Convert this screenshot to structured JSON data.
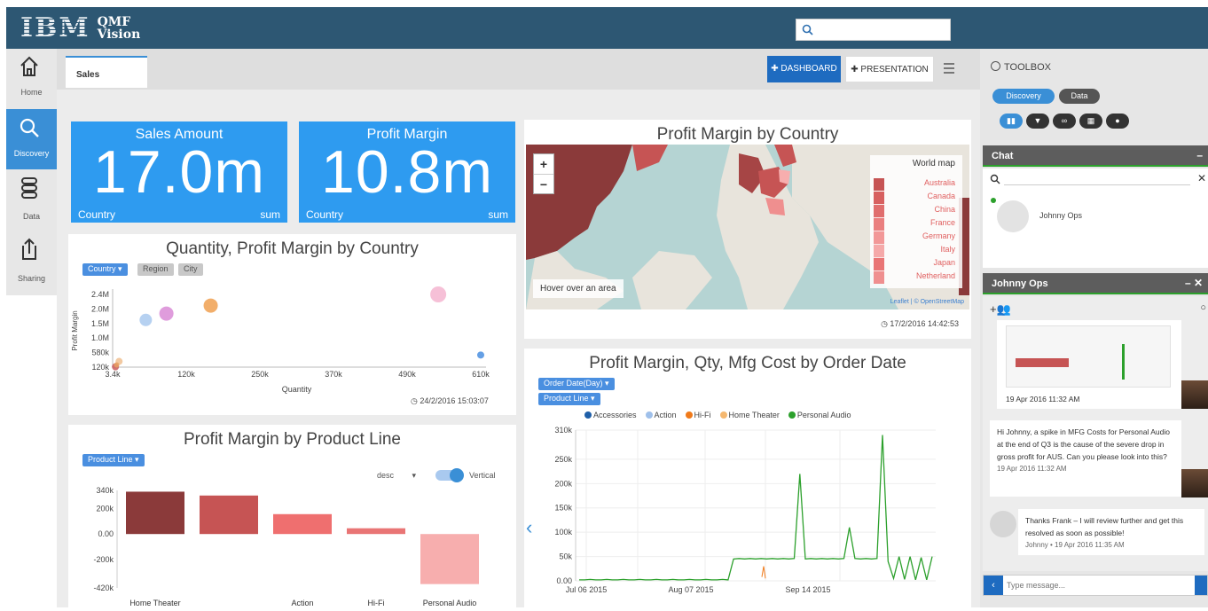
{
  "header": {
    "logo_brand": "IBM",
    "logo_product_line1": "QMF",
    "logo_product_line2": "Vision"
  },
  "nav": [
    {
      "label": "Home",
      "icon": "home-icon"
    },
    {
      "label": "Discovery",
      "icon": "search-icon",
      "active": true
    },
    {
      "label": "Data",
      "icon": "database-icon"
    },
    {
      "label": "Sharing",
      "icon": "share-icon"
    }
  ],
  "tabs": [
    {
      "label": "Sales"
    }
  ],
  "toolbar": {
    "dashboard_label": "✚ DASHBOARD",
    "presentation_label": "✚ PRESENTATION"
  },
  "kpis": [
    {
      "title": "Sales Amount",
      "value": "17.0m",
      "left_label": "Country",
      "right_label": "sum"
    },
    {
      "title": "Profit Margin",
      "value": "10.8m",
      "left_label": "Country",
      "right_label": "sum"
    }
  ],
  "scatter_panel": {
    "title": "Quantity, Profit Margin by Country",
    "chips": [
      "Country ▾",
      "Region",
      "City"
    ],
    "timestamp": "◷ 24/2/2016 15:03:07"
  },
  "product_panel": {
    "title": "Profit Margin by Product Line",
    "chip": "Product Line ▾",
    "sort_value": "desc",
    "vertical_label": "Vertical"
  },
  "map_panel": {
    "title": "Profit Margin by Country",
    "zoom_in": "+",
    "zoom_out": "−",
    "legend_title": "World map",
    "legend_items": [
      "Australia",
      "Canada",
      "China",
      "France",
      "Germany",
      "Italy",
      "Japan",
      "Netherland"
    ],
    "hover_text": "Hover over an area",
    "attribution": "Leaflet | © OpenStreetMap",
    "timestamp": "◷ 17/2/2016 14:42:53"
  },
  "line_panel": {
    "title": "Profit Margin, Qty, Mfg Cost by Order Date",
    "chips": [
      "Order Date(Day) ▾",
      "Product Line ▾"
    ]
  },
  "toolbox": {
    "title": "TOOLBOX",
    "tabs": [
      "Discovery",
      "Data"
    ],
    "chat_title": "Chat",
    "chat_user": "Johnny Ops",
    "conv_title": "Johnny Ops",
    "messages": [
      {
        "text": "19 Apr 2016 11:32 AM"
      },
      {
        "text": "Hi Johnny, a spike in MFG Costs for Personal Audio at the end of Q3 is the cause of the severe drop in gross profit for AUS. Can you please look into this?",
        "time": "19 Apr 2016 11:32 AM"
      },
      {
        "text": "Thanks Frank – I will review further and get this resolved as soon as possible!",
        "time": "Johnny • 19 Apr 2016 11:35 AM"
      }
    ],
    "message_placeholder": "Type message..."
  },
  "chart_data": [
    {
      "type": "scatter",
      "title": "Quantity, Profit Margin by Country",
      "xlabel": "Quantity",
      "ylabel": "Profit Margin",
      "xticks": [
        "3.4k",
        "120k",
        "250k",
        "370k",
        "490k",
        "610k"
      ],
      "yticks": [
        "120k",
        "580k",
        "1.0M",
        "1.5M",
        "2.0M",
        "2.4M"
      ],
      "xlim": [
        3400,
        610000
      ],
      "ylim": [
        120000,
        2400000
      ],
      "points": [
        {
          "x": 8000,
          "y": 130000,
          "color": "#c95a5a",
          "r": 4
        },
        {
          "x": 14000,
          "y": 300000,
          "color": "#f0c090",
          "r": 4
        },
        {
          "x": 10000,
          "y": 190000,
          "color": "#e8a060",
          "r": 3
        },
        {
          "x": 58000,
          "y": 1600000,
          "color": "#a9c9ef",
          "r": 7
        },
        {
          "x": 92000,
          "y": 1800000,
          "color": "#d98bd6",
          "r": 8
        },
        {
          "x": 165000,
          "y": 2050000,
          "color": "#f0a050",
          "r": 8
        },
        {
          "x": 540000,
          "y": 2450000,
          "color": "#f5b5d0",
          "r": 9
        },
        {
          "x": 610000,
          "y": 500000,
          "color": "#4a8fe0",
          "r": 4
        }
      ]
    },
    {
      "type": "bar",
      "title": "Profit Margin by Product Line",
      "categories": [
        "Home Theater",
        "",
        "Action",
        "Hi-Fi",
        "Personal Audio"
      ],
      "values": [
        330000,
        300000,
        155000,
        45000,
        -390000
      ],
      "colors": [
        "#8b3a3a",
        "#c65454",
        "#ef6f6f",
        "#e97575",
        "#f7aeae"
      ],
      "yticks": [
        "340k",
        "200k",
        "0.00",
        "-200k",
        "-420k"
      ],
      "ylim": [
        -420000,
        340000
      ]
    },
    {
      "type": "line",
      "title": "Profit Margin, Qty, Mfg Cost by Order Date",
      "legend": [
        {
          "name": "Accessories",
          "color": "#1f5fa8"
        },
        {
          "name": "Action",
          "color": "#9fc0ea"
        },
        {
          "name": "Hi-Fi",
          "color": "#f07a1a"
        },
        {
          "name": "Home Theater",
          "color": "#f5b870"
        },
        {
          "name": "Personal Audio",
          "color": "#2ca02c"
        }
      ],
      "yticks": [
        "0.00",
        "50k",
        "100k",
        "150k",
        "200k",
        "250k",
        "310k"
      ],
      "xticks": [
        "Jul 06 2015",
        "Aug 07 2015",
        "Sep 14 2015"
      ],
      "ylim": [
        0,
        310000
      ],
      "series": [
        {
          "name": "Personal Audio",
          "values": [
            2000,
            2000,
            3000,
            2000,
            2000,
            3000,
            2000,
            2000,
            3000,
            2000,
            2000,
            3000,
            2000,
            2000,
            3000,
            2000,
            2000,
            3000,
            2000,
            2000,
            3000,
            2000,
            2000,
            3000,
            2000,
            2000,
            3000,
            2000,
            45000,
            46000,
            45000,
            46000,
            45000,
            46000,
            45000,
            46000,
            45000,
            46000,
            45000,
            46000,
            220000,
            45000,
            46000,
            45000,
            46000,
            45000,
            46000,
            45000,
            46000,
            110000,
            46000,
            45000,
            46000,
            45000,
            46000,
            300000,
            40000,
            5000,
            50000,
            3000,
            50000,
            2000,
            48000,
            2000,
            50000
          ]
        },
        {
          "name": "Hi-Fi",
          "points": [
            [
              10,
              8000
            ],
            [
              11,
              30000
            ],
            [
              12,
              5000
            ]
          ]
        }
      ]
    }
  ]
}
